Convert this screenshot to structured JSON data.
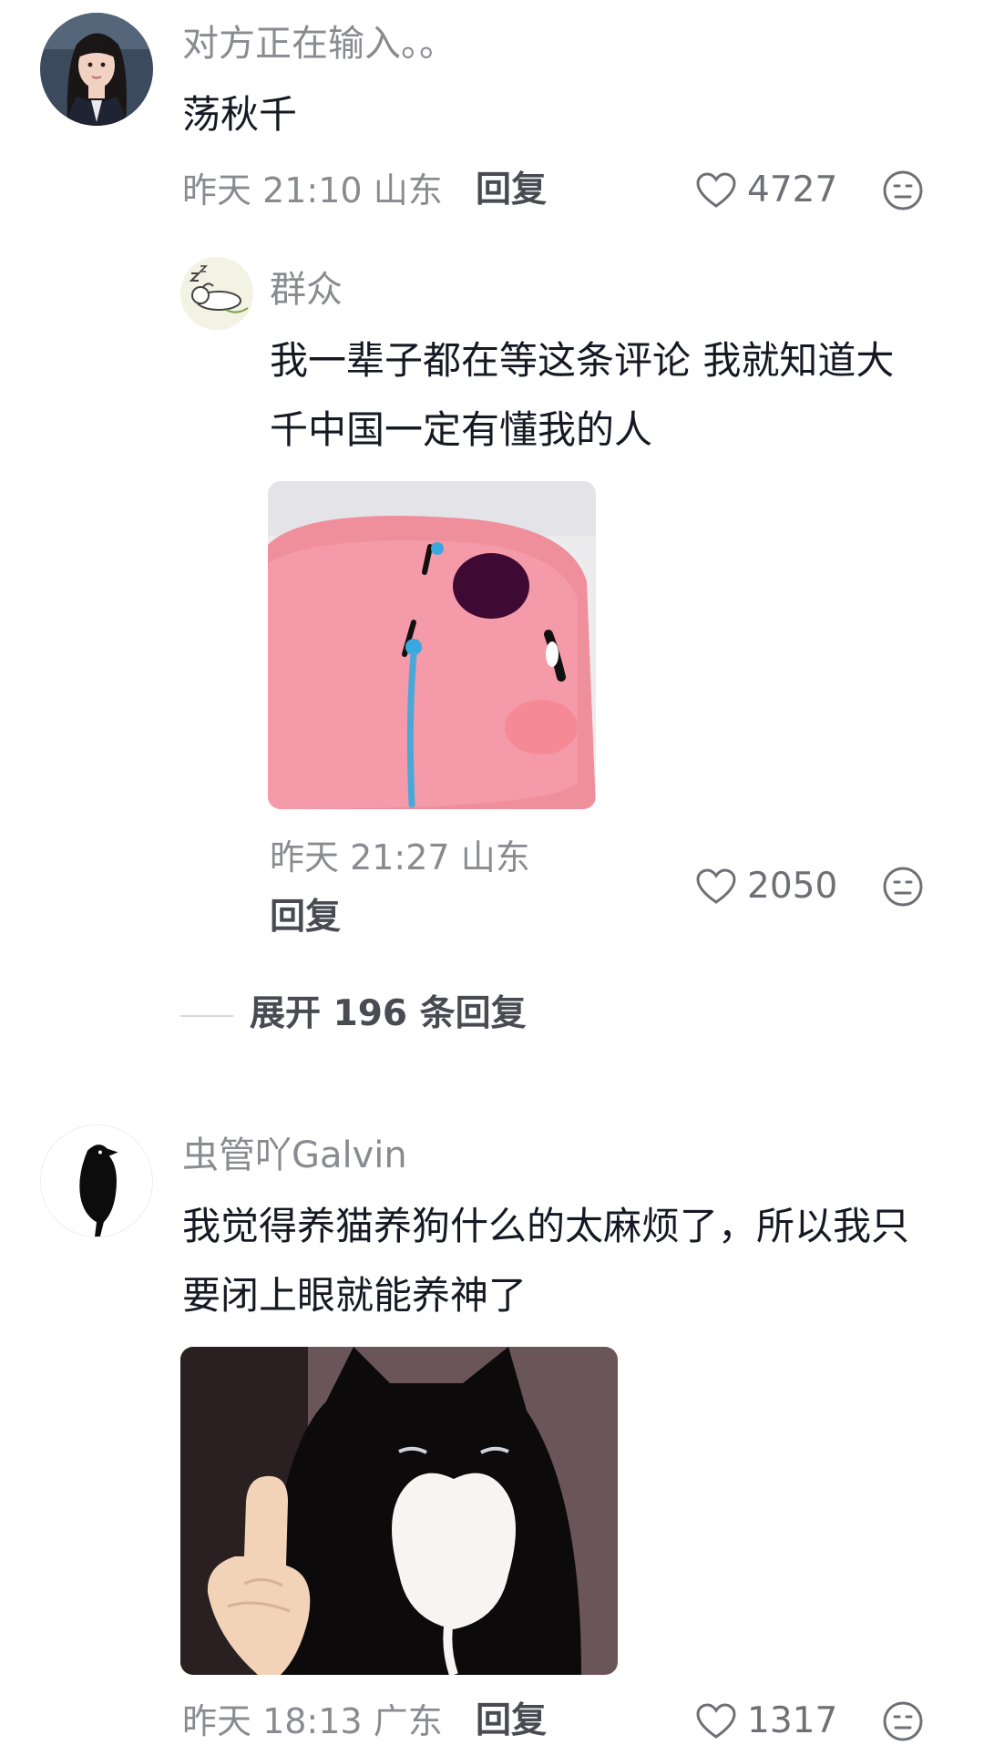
{
  "comments": [
    {
      "username": "对方正在输入。。",
      "text": "荡秋千",
      "time": "昨天 21:10",
      "location": "山东",
      "reply_label": "回复",
      "likes": "4727",
      "avatar_icon": "girl-portrait-avatar",
      "replies": [
        {
          "username": "群众",
          "text": "我一辈子都在等这条评论   我就知道大千中国一定有懂我的人",
          "time": "昨天 21:27",
          "location": "山东",
          "reply_label": "回复",
          "likes": "2050",
          "avatar_icon": "sleeping-bunny-avatar",
          "image": "crying-pink-blob-sticker"
        }
      ],
      "expand_label": "展开 196 条回复"
    },
    {
      "username": "虫管吖Galvin",
      "text": "我觉得养猫养狗什么的太麻烦了，所以我只要闭上眼就能养神了",
      "time": "昨天 18:13",
      "location": "广东",
      "reply_label": "回复",
      "likes": "1317",
      "avatar_icon": "black-crow-avatar",
      "image": "pointing-cat-sticker"
    }
  ],
  "colors": {
    "meta": "#8a8b91",
    "text": "#161823",
    "reply": "#4a4b52"
  }
}
